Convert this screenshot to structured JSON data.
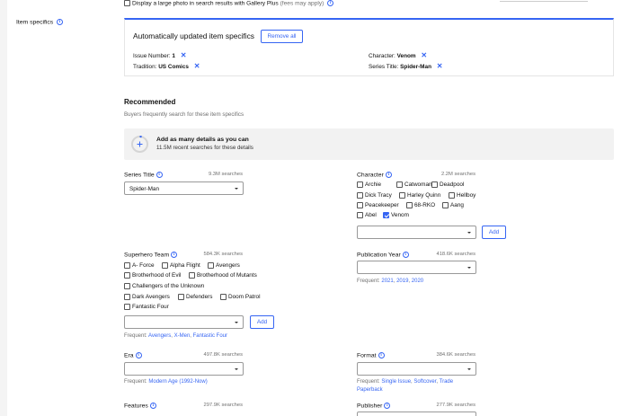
{
  "gallery": {
    "label": "Display a large photo in search results with Gallery Plus",
    "fees": "(fees may apply)"
  },
  "item_specifics": {
    "label": "Item specifics"
  },
  "auto": {
    "title": "Automatically updated item specifics",
    "remove_all": "Remove all",
    "items": [
      {
        "name": "Issue Number:",
        "value": "1"
      },
      {
        "name": "Character:",
        "value": "Venom"
      },
      {
        "name": "Tradition:",
        "value": "US Comics"
      },
      {
        "name": "Series Title:",
        "value": "Spider-Man"
      }
    ]
  },
  "recommended": {
    "title": "Recommended",
    "subtitle": "Buyers frequently search for these item specifics",
    "banner_title": "Add as many details as you can",
    "banner_sub": "11.5M recent searches for these details"
  },
  "fields": {
    "series_title": {
      "label": "Series Title",
      "count": "9.3M searches",
      "value": "Spider-Man"
    },
    "character": {
      "label": "Character",
      "count": "2.2M searches",
      "options": [
        {
          "label": "Archie",
          "checked": false
        },
        {
          "label": "Catwoman",
          "checked": false
        },
        {
          "label": "Deadpool",
          "checked": false
        },
        {
          "label": "Dick Tracy",
          "checked": false
        },
        {
          "label": "Harley Quinn",
          "checked": false
        },
        {
          "label": "Hellboy",
          "checked": false
        },
        {
          "label": "Peacekeeper",
          "checked": false
        },
        {
          "label": "68-RKO",
          "checked": false
        },
        {
          "label": "Aang",
          "checked": false
        },
        {
          "label": "Abel",
          "checked": false
        },
        {
          "label": "Venom",
          "checked": true
        }
      ],
      "add": "Add"
    },
    "superhero_team": {
      "label": "Superhero Team",
      "count": "584.3K searches",
      "options": [
        {
          "label": "A- Force",
          "checked": false
        },
        {
          "label": "Alpha Flight",
          "checked": false
        },
        {
          "label": "Avengers",
          "checked": false
        },
        {
          "label": "Brotherhood of Evil",
          "checked": false
        },
        {
          "label": "Brotherhood of Mutants",
          "checked": false
        },
        {
          "label": "Challengers of the Unknown",
          "checked": false
        },
        {
          "label": "Dark Avengers",
          "checked": false
        },
        {
          "label": "Defenders",
          "checked": false
        },
        {
          "label": "Doom Patrol",
          "checked": false
        },
        {
          "label": "Fantastic Four",
          "checked": false
        }
      ],
      "add": "Add",
      "frequent_label": "Frequent:",
      "frequent": [
        "Avengers",
        "X-Men",
        "Fantastic Four"
      ]
    },
    "publication_year": {
      "label": "Publication Year",
      "count": "418.6K searches",
      "frequent_label": "Frequent:",
      "frequent": [
        "2021",
        "2019",
        "2020"
      ]
    },
    "era": {
      "label": "Era",
      "count": "497.8K searches",
      "frequent_label": "Frequent:",
      "frequent": [
        "Modern Age (1992-Now)"
      ]
    },
    "format": {
      "label": "Format",
      "count": "384.6K searches",
      "frequent_label": "Frequent:",
      "frequent": [
        "Single Issue",
        "Softcover",
        "Trade Paperback"
      ]
    },
    "features": {
      "label": "Features",
      "count": "297.9K searches"
    },
    "publisher": {
      "label": "Publisher",
      "count": "277.9K searches"
    }
  },
  "colors": {
    "accent": "#3665f3",
    "muted": "#707070",
    "banner_bg": "#f2f2f2"
  },
  "icons": {
    "info": "info-icon",
    "remove": "x-icon",
    "progress": "progress-ring-icon",
    "dropdown": "chevron-down-icon"
  }
}
